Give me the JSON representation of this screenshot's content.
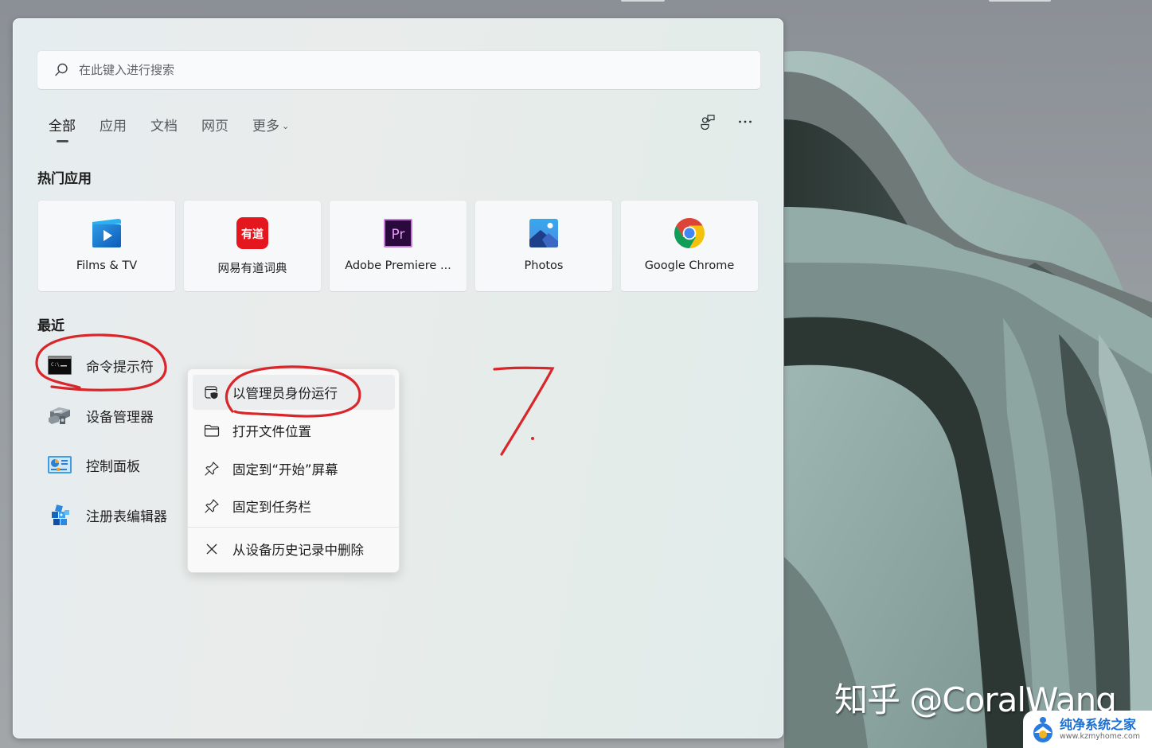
{
  "search": {
    "placeholder": "在此键入进行搜索"
  },
  "tabs": [
    {
      "label": "全部",
      "active": true
    },
    {
      "label": "应用",
      "active": false
    },
    {
      "label": "文档",
      "active": false
    },
    {
      "label": "网页",
      "active": false
    },
    {
      "label": "更多",
      "active": false,
      "has_dropdown": true
    }
  ],
  "header_icons": [
    {
      "name": "account-feedback-icon"
    },
    {
      "name": "more-options-icon",
      "glyph": "···"
    }
  ],
  "top_apps": {
    "title": "热门应用",
    "items": [
      {
        "label": "Films & TV",
        "icon": "films-tv-icon"
      },
      {
        "label": "网易有道词典",
        "icon": "youdao-dict-icon",
        "icon_text": "有道"
      },
      {
        "label": "Adobe Premiere ...",
        "icon": "adobe-premiere-icon",
        "icon_text": "Pr"
      },
      {
        "label": "Photos",
        "icon": "photos-icon"
      },
      {
        "label": "Google Chrome",
        "icon": "chrome-icon"
      }
    ]
  },
  "recent": {
    "title": "最近",
    "items": [
      {
        "label": "命令提示符",
        "icon": "command-prompt-icon"
      },
      {
        "label": "设备管理器",
        "icon": "device-manager-icon"
      },
      {
        "label": "控制面板",
        "icon": "control-panel-icon"
      },
      {
        "label": "注册表编辑器",
        "icon": "registry-editor-icon"
      }
    ]
  },
  "context_menu": {
    "items": [
      {
        "label": "以管理员身份运行",
        "icon": "run-as-admin-shield-icon",
        "highlighted": true
      },
      {
        "label": "打开文件位置",
        "icon": "folder-icon"
      },
      {
        "label": "固定到“开始”屏幕",
        "icon": "pin-icon"
      },
      {
        "label": "固定到任务栏",
        "icon": "pin-icon"
      },
      {
        "label": "从设备历史记录中删除",
        "icon": "close-x-icon"
      }
    ]
  },
  "annotations": {
    "step_number": "7.",
    "ink_color": "#d9262b"
  },
  "watermark": {
    "text": "知乎 @CoralWang"
  },
  "site_badge": {
    "name": "纯净系统之家",
    "url": "www.kzmyhome.com"
  },
  "colors": {
    "youdao_red": "#e5171e",
    "premiere_purple": "#2a0a3d",
    "premiere_text": "#e59af6",
    "chrome_red": "#db4437",
    "chrome_yellow": "#f4c20d",
    "chrome_green": "#0f9d58",
    "chrome_blue": "#4285f4"
  }
}
